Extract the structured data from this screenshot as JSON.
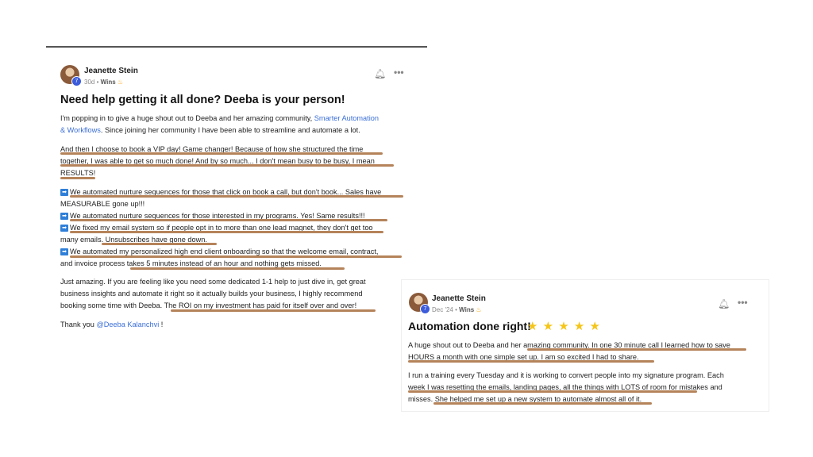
{
  "post1": {
    "author": "Jeanette Stein",
    "level": "7",
    "time": "30d",
    "category": "Wins",
    "title": "Need help getting it all done? Deeba is your person!",
    "intro_1a": "I'm popping in to give a huge shout out to Deeba and her amazing community, ",
    "intro_link_1": "Smarter Automation",
    "intro_link_2": "& Workflows",
    "intro_2b": ". Since joining her community I have been able to streamline and automate a lot.",
    "p2_l1": "And then I choose to book a VIP day! Game changer! Because of how she structured the time",
    "p2_l2": "together, I was able to get so much done! And by so much... I don't mean busy to be busy, I mean",
    "p2_l3": "RESULTS!",
    "b1_l1": "We automated nurture sequences for those that click on book a call, but don't book... Sales have",
    "b1_l2": "MEASURABLE gone up!!!",
    "b2_l1": "We automated nurture sequences for those interested in my programs. Yes! Same results!!!",
    "b3_l1": "We fixed my email system so if people opt in to more than one lead magnet, they don't get too",
    "b3_l2": "many emails. Unsubscribes have gone down.",
    "b4_l1": "We automated my personalized high end client onboarding so that the welcome email, contract,",
    "b4_l2": "and invoice process takes 5 minutes instead of an hour and nothing gets missed.",
    "p4_l1": "Just amazing. If you are feeling like you need some dedicated 1-1 help to just dive in, get great",
    "p4_l2": "business insights and automate it right so it actually builds your business, I highly recommend",
    "p4_l3": "booking some time with Deeba. The ROI on my investment has paid for itself over and over!",
    "thanks_a": "Thank you ",
    "thanks_mention": "@Deeba Kalanchvi",
    "thanks_b": " !"
  },
  "post2": {
    "author": "Jeanette Stein",
    "level": "7",
    "time": "Dec '24",
    "category": "Wins",
    "title": "Automation done right!",
    "stars": "★ ★ ★ ★ ★",
    "p1_l1": "A huge shout out to Deeba and her amazing community. In one 30 minute call I learned how to save",
    "p1_l2": "HOURS a month with one simple set up. I am so excited I had to share.",
    "p2_l1": "I run a training every Tuesday and it is working to convert people into my signature program. Each",
    "p2_l2": "week I was resetting the emails, landing pages, all the things with LOTS of room for mistakes and",
    "p2_l3": "misses. She helped me set up a new system to automate almost all of it."
  },
  "icons": {
    "bell": "bell-icon",
    "more": "more-icon",
    "arrow": "arrow-right-icon",
    "flame": "flame-icon",
    "star": "star-icon"
  },
  "colors": {
    "underline": "#b5835a",
    "link": "#3b6fd6",
    "arrow": "#2f7fd8",
    "star": "#f5c518",
    "level_badge": "#3b5bdb"
  }
}
